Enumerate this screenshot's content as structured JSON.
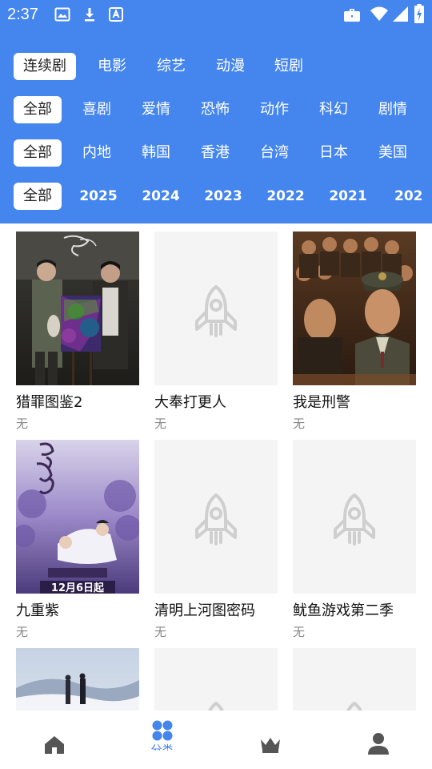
{
  "status_bar": {
    "time": "2:37"
  },
  "filters": {
    "types": [
      "连续剧",
      "电影",
      "综艺",
      "动漫",
      "短剧"
    ],
    "genres": [
      "全部",
      "喜剧",
      "爱情",
      "恐怖",
      "动作",
      "科幻",
      "剧情"
    ],
    "regions": [
      "全部",
      "内地",
      "韩国",
      "香港",
      "台湾",
      "日本",
      "美国"
    ],
    "years": [
      "全部",
      "2025",
      "2024",
      "2023",
      "2022",
      "2021",
      "202"
    ]
  },
  "items": [
    {
      "title": "猎罪图鉴2",
      "sub": "无"
    },
    {
      "title": "大奉打更人",
      "sub": "无"
    },
    {
      "title": "我是刑警",
      "sub": "无"
    },
    {
      "title": "九重紫",
      "sub": "无"
    },
    {
      "title": "清明上河图密码",
      "sub": "无"
    },
    {
      "title": "鱿鱼游戏第二季",
      "sub": "无"
    }
  ],
  "poster_texts": {
    "p3_caption": "12月6日起"
  },
  "nav": {
    "active_label": "分类"
  },
  "colors": {
    "accent": "#4586EE",
    "placeholder_bg": "#F4F4F4",
    "icon_grey": "#555555"
  }
}
